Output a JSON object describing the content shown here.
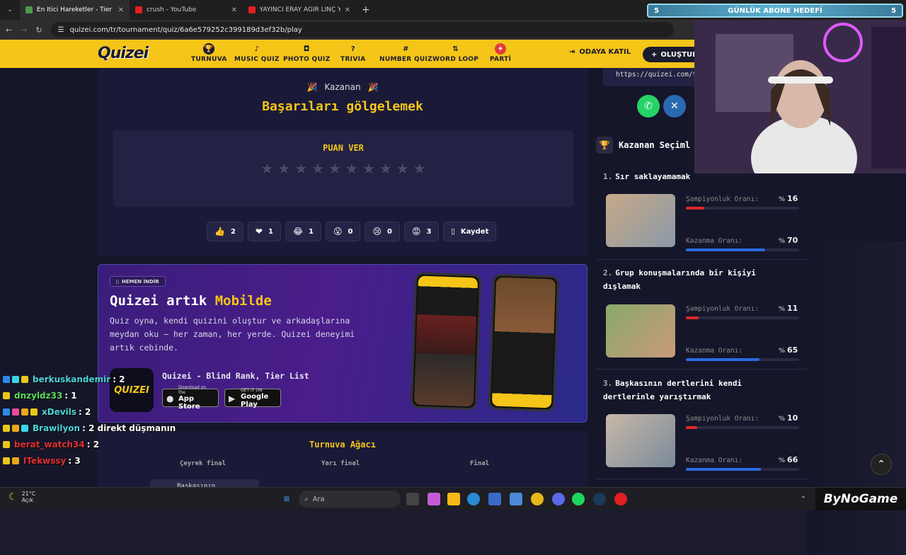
{
  "browser": {
    "tabs": [
      {
        "title": "En İtici Hareketler - Tier List, Kö...",
        "color": "#4a9a4a"
      },
      {
        "title": "crush - YouTube",
        "color": "#e02020"
      },
      {
        "title": "YAYINCI ERAY AĞIR LİNÇ YEDİ",
        "color": "#e02020"
      }
    ],
    "new_tab": "+",
    "url": "quizei.com/tr/tournament/quiz/6a6e579252c399189d3ef32b/play"
  },
  "nav": {
    "logo": "Quizei",
    "items": [
      {
        "label": "TURNUVA",
        "icon": "trophy-icon",
        "glyph": "🏆"
      },
      {
        "label": "MUSIC QUIZ",
        "icon": "music-icon",
        "glyph": "♪"
      },
      {
        "label": "PHOTO QUIZ",
        "icon": "camera-icon",
        "glyph": "◘"
      },
      {
        "label": "TRIVIA",
        "icon": "question-icon",
        "glyph": "?"
      },
      {
        "label": "NUMBER QUIZ",
        "icon": "hash-icon",
        "glyph": "#"
      },
      {
        "label": "WORD LOOP",
        "icon": "sort-icon",
        "glyph": "⇅"
      },
      {
        "label": "PARTİ",
        "icon": "party-icon",
        "glyph": "✦"
      }
    ],
    "join": "ODAYA KATIL",
    "create": "OLUŞTUR"
  },
  "winner": {
    "tag": "Kazanan",
    "title": "Başarıları gölgelemek",
    "rate_label": "PUAN VER",
    "star_count": 10,
    "reactions": [
      {
        "emoji": "👍",
        "count": "2"
      },
      {
        "emoji": "❤",
        "count": "1"
      },
      {
        "emoji": "😂",
        "count": "1"
      },
      {
        "emoji": "😮",
        "count": "0"
      },
      {
        "emoji": "😢",
        "count": "0"
      },
      {
        "emoji": "😡",
        "count": "3"
      }
    ],
    "save_label": "Kaydet"
  },
  "mobile": {
    "pill": "HEMEN İNDİR",
    "title_prefix": "Quizei artık ",
    "title_highlight": "Mobilde",
    "desc": "Quiz oyna, kendi quizini oluştur ve arkadaşlarına meydan oku — her zaman, her yerde. Quizei deneyimi artık cebinde.",
    "app_name": "Quizei - Blind Rank, Tier List",
    "app_icon_text": "QUIZEI",
    "appstore_small": "Download on the",
    "appstore_big": "App Store",
    "play_small": "GET IT ON",
    "play_big": "Google Play"
  },
  "tree": {
    "title": "Turnuva Ağacı",
    "rounds": [
      "Çeyrek final",
      "Yarı final",
      "Final"
    ],
    "first_item": "Başkasının"
  },
  "sidebar": {
    "share_url": "https://quizei.com/t",
    "selection_title": "Kazanan Seçiml",
    "champ_label": "Şampiyonluk Oranı:",
    "win_label": "Kazanma Oranı:",
    "candidates": [
      {
        "rank": "1.",
        "title": "Sır saklayamamak",
        "champ": "16",
        "win": "70"
      },
      {
        "rank": "2.",
        "title": "Grup konuşmalarında bir kişiyi dışlamak",
        "champ": "11",
        "win": "65"
      },
      {
        "rank": "3.",
        "title": "Başkasının dertlerini kendi dertlerinle yarıştırmak",
        "champ": "10",
        "win": "66"
      }
    ]
  },
  "stream": {
    "goal_left": "5",
    "goal_title": "GÜNLÜK ABONE HEDEFİ",
    "goal_right": "5",
    "chat": [
      {
        "user": "berkuskandemir",
        "msg": ": 2",
        "color": "#4ad4d4"
      },
      {
        "user": "dnzyldz33",
        "msg": ": 1",
        "color": "#5adc5a"
      },
      {
        "user": "xDevils",
        "msg": ": 2",
        "color": "#4ad4d4"
      },
      {
        "user": "Brawilyon",
        "msg": ": 2 direkt düşmanın",
        "color": "#4ad4d4"
      },
      {
        "user": "berat_watch34",
        "msg": ": 2",
        "color": "#e03030"
      },
      {
        "user": "ITekwssy",
        "msg": ": 3",
        "color": "#e03030"
      }
    ],
    "brand": "ByNoGame"
  },
  "taskbar": {
    "temp": "21°C",
    "weather": "Açık",
    "search": "Ara"
  }
}
